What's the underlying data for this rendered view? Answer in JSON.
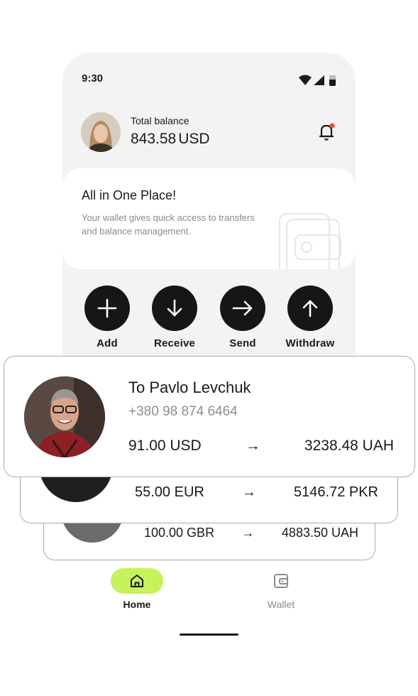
{
  "status_bar": {
    "time": "9:30"
  },
  "header": {
    "total_label": "Total balance",
    "balance_amount": "843.58",
    "balance_currency": "USD"
  },
  "promo": {
    "title": "All in One Place!",
    "text": "Your wallet gives quick access to transfers and balance management."
  },
  "actions": [
    {
      "label": "Add",
      "icon": "plus-icon"
    },
    {
      "label": "Receive",
      "icon": "arrow-down-icon"
    },
    {
      "label": "Send",
      "icon": "arrow-right-icon"
    },
    {
      "label": "Withdraw",
      "icon": "arrow-up-icon"
    }
  ],
  "transfers": [
    {
      "recipient": "To Pavlo Levchuk",
      "phone": "+380 98 874 6464",
      "from": "91.00 USD",
      "arrow": "→",
      "to": "3238.48 UAH"
    },
    {
      "from": "55.00 EUR",
      "arrow": "→",
      "to": "5146.72 PKR"
    },
    {
      "from": "100.00 GBR",
      "arrow": "→",
      "to": "4883.50 UAH"
    }
  ],
  "bottom_nav": {
    "home_label": "Home",
    "wallet_label": "Wallet"
  },
  "colors": {
    "accent": "#c6f25b",
    "notification_dot": "#f04a2b",
    "action_button": "#161616",
    "background": "#f3f3f3"
  }
}
